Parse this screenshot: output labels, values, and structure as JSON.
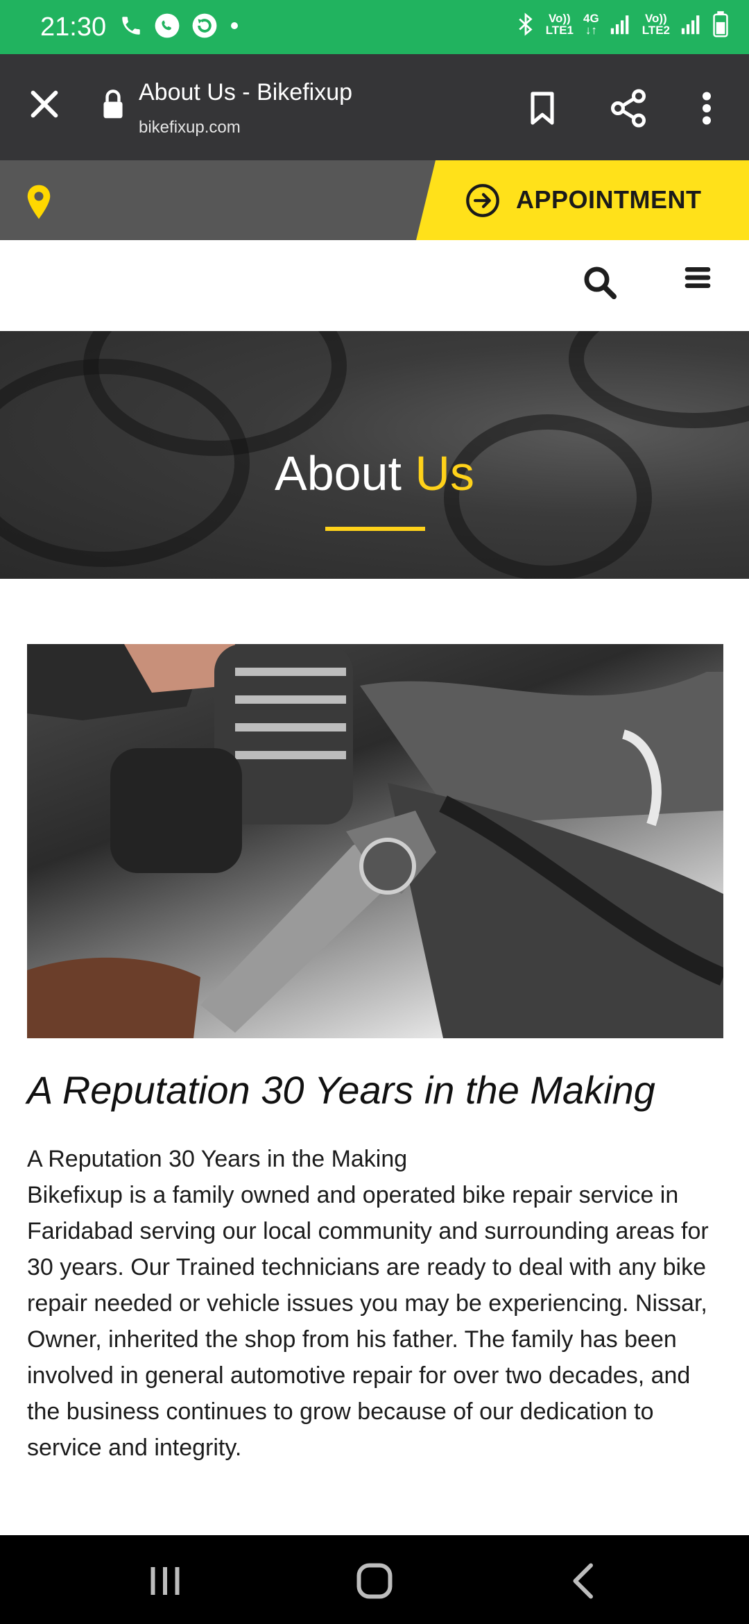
{
  "status_bar": {
    "time": "21:30",
    "net1_top": "Vo))",
    "net1_bottom": "LTE1",
    "net_gen": "4G",
    "net2_top": "Vo))",
    "net2_bottom": "LTE2",
    "color": "#21b35f"
  },
  "browser": {
    "title": "About Us - Bikefixup",
    "url": "bikefixup.com"
  },
  "site": {
    "appointment_label": "APPOINTMENT",
    "accent_color": "#ffe11a"
  },
  "hero": {
    "title_main": "About",
    "title_accent": "Us"
  },
  "content": {
    "heading": "A Reputation 30 Years in the Making",
    "subheading": "A Reputation 30 Years in the Making",
    "body": "Bikefixup is a family owned and operated bike repair service in Faridabad serving our local community and surrounding areas for 30 years. Our Trained technicians are ready to deal with any bike repair needed or vehicle issues you may be experiencing. Nissar, Owner, inherited the shop from his father. The family has been involved in general automotive repair for over two decades, and the business continues to grow because of our dedication to service and integrity."
  },
  "icons": {
    "close": "close-icon",
    "lock": "lock-icon",
    "bookmark": "bookmark-icon",
    "share": "share-icon",
    "more": "more-vertical-icon",
    "location": "location-pin-icon",
    "arrow": "arrow-right-circle-icon",
    "search": "search-icon",
    "menu": "hamburger-menu-icon"
  }
}
